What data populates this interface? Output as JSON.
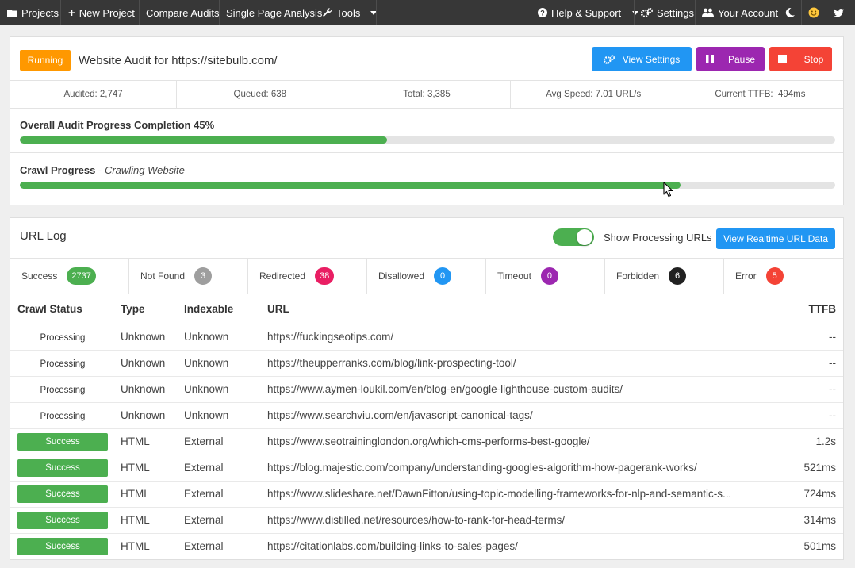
{
  "nav": {
    "projects": "Projects",
    "new_project": "New Project",
    "compare_audits": "Compare Audits",
    "single_page_analysis": "Single Page Analysis",
    "tools": "Tools",
    "help_support": "Help & Support",
    "settings": "Settings",
    "your_account": "Your Account"
  },
  "audit": {
    "status": "Running",
    "title": "Website Audit for https://sitebulb.com/",
    "buttons": {
      "view_settings": "View Settings",
      "pause": "Pause",
      "stop": "Stop"
    },
    "stats": [
      "Audited: 2,747",
      "Queued: 638",
      "Total: 3,385",
      "Avg Speed: 7.01 URL/s",
      "Current TTFB:  494ms"
    ],
    "overall_label": "Overall Audit Progress Completion 45%",
    "overall_progress": 0.45,
    "crawl_label": "Crawl Progress",
    "crawl_sep": " - ",
    "crawl_sublabel": "Crawling Website",
    "crawl_progress": 0.81
  },
  "url_log": {
    "title": "URL Log",
    "toggle_on": true,
    "toggle_label": "Show Processing URLs",
    "realtime_button": "View Realtime URL Data",
    "status_counts": [
      {
        "label": "Success",
        "count": "2737",
        "color": "#4caf50"
      },
      {
        "label": "Not Found",
        "count": "3",
        "color": "#9e9e9e"
      },
      {
        "label": "Redirected",
        "count": "38",
        "color": "#e91e63"
      },
      {
        "label": "Disallowed",
        "count": "0",
        "color": "#2196f3"
      },
      {
        "label": "Timeout",
        "count": "0",
        "color": "#9c27b0"
      },
      {
        "label": "Forbidden",
        "count": "6",
        "color": "#212121"
      },
      {
        "label": "Error",
        "count": "5",
        "color": "#f44336"
      }
    ],
    "columns": {
      "crawl_status": "Crawl Status",
      "type": "Type",
      "indexable": "Indexable",
      "url": "URL",
      "ttfb": "TTFB"
    },
    "rows": [
      {
        "status": "Processing",
        "type": "Unknown",
        "indexable": "Unknown",
        "url": "https://fuckingseotips.com/",
        "ttfb": "--"
      },
      {
        "status": "Processing",
        "type": "Unknown",
        "indexable": "Unknown",
        "url": "https://theupperranks.com/blog/link-prospecting-tool/",
        "ttfb": "--"
      },
      {
        "status": "Processing",
        "type": "Unknown",
        "indexable": "Unknown",
        "url": "https://www.aymen-loukil.com/en/blog-en/google-lighthouse-custom-audits/",
        "ttfb": "--"
      },
      {
        "status": "Processing",
        "type": "Unknown",
        "indexable": "Unknown",
        "url": "https://www.searchviu.com/en/javascript-canonical-tags/",
        "ttfb": "--"
      },
      {
        "status": "Success",
        "type": "HTML",
        "indexable": "External",
        "url": "https://www.seotraininglondon.org/which-cms-performs-best-google/",
        "ttfb": "1.2s"
      },
      {
        "status": "Success",
        "type": "HTML",
        "indexable": "External",
        "url": "https://blog.majestic.com/company/understanding-googles-algorithm-how-pagerank-works/",
        "ttfb": "521ms"
      },
      {
        "status": "Success",
        "type": "HTML",
        "indexable": "External",
        "url": "https://www.slideshare.net/DawnFitton/using-topic-modelling-frameworks-for-nlp-and-semantic-s...",
        "ttfb": "724ms"
      },
      {
        "status": "Success",
        "type": "HTML",
        "indexable": "External",
        "url": "https://www.distilled.net/resources/how-to-rank-for-head-terms/",
        "ttfb": "314ms"
      },
      {
        "status": "Success",
        "type": "HTML",
        "indexable": "External",
        "url": "https://citationlabs.com/building-links-to-sales-pages/",
        "ttfb": "501ms"
      }
    ]
  }
}
